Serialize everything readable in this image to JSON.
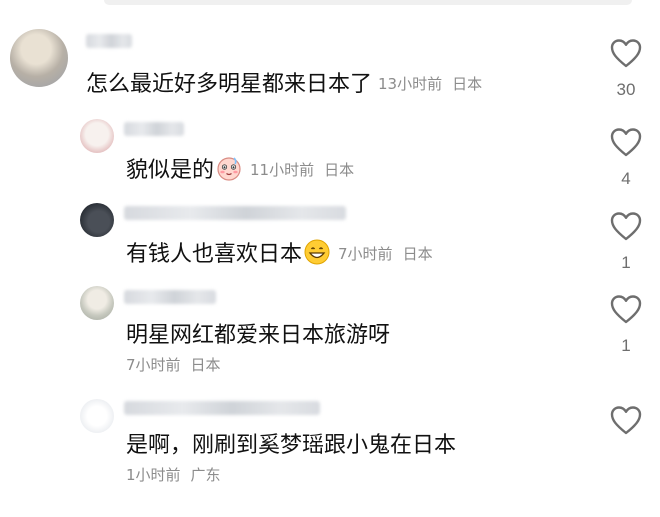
{
  "comments": [
    {
      "text": "怎么最近好多明星都来日本了",
      "time": "13小时前",
      "location": "日本",
      "likes": "30",
      "icon": "heart-outline-icon"
    },
    {
      "text": "貌似是的",
      "emoji": "blushing-face-emoji",
      "time": "11小时前",
      "location": "日本",
      "likes": "4",
      "icon": "heart-outline-icon"
    },
    {
      "text": "有钱人也喜欢日本",
      "emoji": "grinning-face-emoji",
      "time": "7小时前",
      "location": "日本",
      "likes": "1",
      "icon": "heart-outline-icon"
    },
    {
      "text": "明星网红都爱来日本旅游呀",
      "time": "7小时前",
      "location": "日本",
      "likes": "1",
      "icon": "heart-outline-icon"
    },
    {
      "text": "是啊，刚刷到奚梦瑶跟小鬼在日本",
      "time": "1小时前",
      "location": "广东",
      "likes": "",
      "icon": "heart-outline-icon"
    }
  ]
}
